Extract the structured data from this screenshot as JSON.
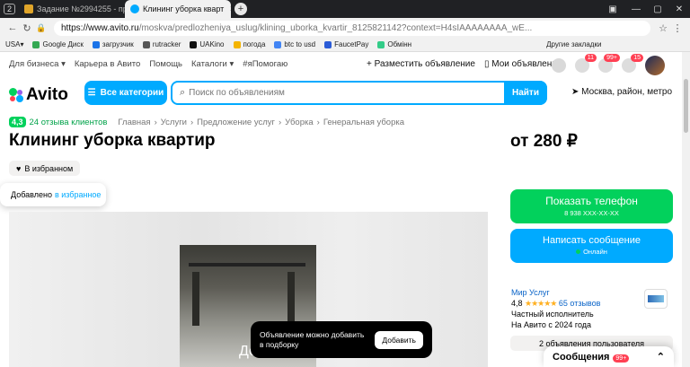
{
  "browser": {
    "tab_counter": "2",
    "tabs": [
      {
        "title": "Задание №2994255 - про",
        "active": false
      },
      {
        "title": "Клининг уборка кварт",
        "active": true
      }
    ],
    "new_tab": "+",
    "url_host": "https://www.avito.ru",
    "url_path": "/moskva/predlozheniya_uslug/klining_uborka_kvartir_8125821142?context=H4sIAAAAAAAA_wE...",
    "bookmarks": [
      "USA",
      "Google Диск",
      "загрузчик",
      "rutracker",
      "UAKino",
      "погода",
      "btc to usd",
      "FaucetPay",
      "Обмінн"
    ],
    "other_bookmarks": "Другие закладки"
  },
  "header": {
    "nav": [
      "Для бизнеса",
      "Карьера в Авито",
      "Помощь",
      "Каталоги",
      "#яПомогаю"
    ],
    "post_ad": "Разместить объявление",
    "my_ads": "Мои объявления",
    "badges": {
      "favorites": "11",
      "messages": "99+",
      "cart": "15"
    },
    "logo": "Avito",
    "categories": "Все категории",
    "search_placeholder": "Поиск по объявлениям",
    "find": "Найти",
    "location": "Москва, район, метро"
  },
  "listing": {
    "rating": "4,3",
    "reviews_link": "24 отзыва клиентов",
    "breadcrumbs": [
      "Главная",
      "Услуги",
      "Предложение услуг",
      "Уборка",
      "Генеральная уборка"
    ],
    "title": "Клининг уборка квартир",
    "price": "от 280 ₽",
    "favorite": "В избранном",
    "toast_text": "Добавлено",
    "toast_link": "в избранное",
    "photo_text": "До"
  },
  "snackbar": {
    "text": "Объявление можно добавить в подборку",
    "button": "Добавить"
  },
  "sidebar": {
    "phone_title": "Показать телефон",
    "phone_number": "8 938 XXX-XX-XX",
    "message_title": "Написать сообщение",
    "message_status": "Онлайн",
    "seller_name": "Мир Услуг",
    "seller_rating": "4,8",
    "seller_stars": "★★★★★",
    "seller_reviews": "65 отзывов",
    "seller_type": "Частный исполнитель",
    "seller_since": "На Авито с 2024 года",
    "seller_ads": "2 объявления пользователя"
  },
  "chat": {
    "label": "Сообщения",
    "badge": "99+"
  }
}
